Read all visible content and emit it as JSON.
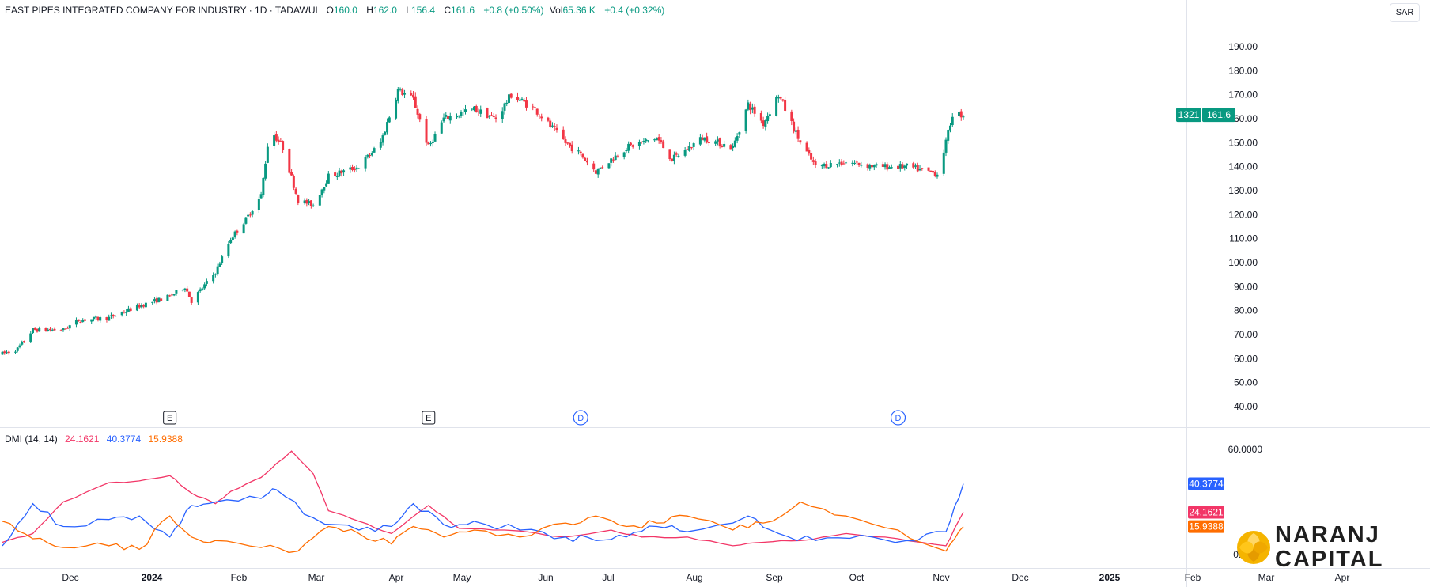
{
  "header": {
    "symbol": "EAST PIPES INTEGRATED COMPANY FOR INDUSTRY · 1D · TADAWUL",
    "open_label": "O",
    "open": "160.0",
    "high_label": "H",
    "high": "162.0",
    "low_label": "L",
    "low": "156.4",
    "close_label": "C",
    "close": "161.6",
    "change": "+0.8 (+0.50%)",
    "vol_label": "Vol",
    "vol": "65.36 K",
    "vol_change": "+0.4 (+0.32%)"
  },
  "currency": "SAR",
  "price_badge": {
    "count": "1321",
    "price": "161.6"
  },
  "dmi": {
    "title": "DMI (14, 14)",
    "minus_di": "24.1621",
    "adx": "40.3774",
    "plus_di": "15.9388"
  },
  "logo": {
    "line1": "NARANJ",
    "line2": "CAPITAL"
  },
  "colors": {
    "up": "#089981",
    "down": "#f23645",
    "minus_di": "#f23667",
    "adx": "#2962ff",
    "plus_di": "#ff6d00"
  },
  "chart_data": [
    {
      "type": "candlestick",
      "title": "EAST PIPES INTEGRATED COMPANY FOR INDUSTRY · 1D · TADAWUL",
      "y_ticks": [
        "40.00",
        "50.00",
        "60.00",
        "70.00",
        "80.00",
        "90.00",
        "100.00",
        "110.00",
        "120.00",
        "130.00",
        "140.00",
        "150.00",
        "160.00",
        "170.00",
        "180.00",
        "190.00"
      ],
      "ylim": [
        35,
        207
      ],
      "x_ticks": [
        "Dec",
        "2024",
        "Feb",
        "Mar",
        "Apr",
        "May",
        "Jun",
        "Jul",
        "Aug",
        "Sep",
        "Oct",
        "Nov",
        "Dec",
        "2025",
        "Feb",
        "Mar",
        "Apr"
      ],
      "close_trend": [
        {
          "date": "2023-11-13",
          "close": 62
        },
        {
          "date": "2023-11-20",
          "close": 64
        },
        {
          "date": "2023-11-27",
          "close": 72
        },
        {
          "date": "2023-12-11",
          "close": 72
        },
        {
          "date": "2023-12-18",
          "close": 76
        },
        {
          "date": "2024-01-01",
          "close": 77
        },
        {
          "date": "2024-01-15",
          "close": 82
        },
        {
          "date": "2024-01-29",
          "close": 86
        },
        {
          "date": "2024-02-05",
          "close": 90
        },
        {
          "date": "2024-02-08",
          "close": 84
        },
        {
          "date": "2024-02-19",
          "close": 96
        },
        {
          "date": "2024-02-26",
          "close": 110
        },
        {
          "date": "2024-03-04",
          "close": 118
        },
        {
          "date": "2024-03-11",
          "close": 128
        },
        {
          "date": "2024-03-15",
          "close": 156
        },
        {
          "date": "2024-03-21",
          "close": 148
        },
        {
          "date": "2024-03-28",
          "close": 126
        },
        {
          "date": "2024-04-04",
          "close": 124
        },
        {
          "date": "2024-04-11",
          "close": 136
        },
        {
          "date": "2024-04-25",
          "close": 140
        },
        {
          "date": "2024-05-05",
          "close": 150
        },
        {
          "date": "2024-05-13",
          "close": 172
        },
        {
          "date": "2024-05-20",
          "close": 168
        },
        {
          "date": "2024-05-27",
          "close": 148
        },
        {
          "date": "2024-06-03",
          "close": 160
        },
        {
          "date": "2024-06-17",
          "close": 164
        },
        {
          "date": "2024-06-27",
          "close": 160
        },
        {
          "date": "2024-07-04",
          "close": 170
        },
        {
          "date": "2024-07-15",
          "close": 164
        },
        {
          "date": "2024-07-29",
          "close": 150
        },
        {
          "date": "2024-08-05",
          "close": 145
        },
        {
          "date": "2024-08-12",
          "close": 138
        },
        {
          "date": "2024-08-26",
          "close": 148
        },
        {
          "date": "2024-09-09",
          "close": 152
        },
        {
          "date": "2024-09-16",
          "close": 143
        },
        {
          "date": "2024-09-30",
          "close": 152
        },
        {
          "date": "2024-10-14",
          "close": 148
        },
        {
          "date": "2024-10-21",
          "close": 166
        },
        {
          "date": "2024-10-28",
          "close": 158
        },
        {
          "date": "2024-11-04",
          "close": 170
        },
        {
          "date": "2024-11-14",
          "close": 150
        },
        {
          "date": "2024-11-21",
          "close": 140
        },
        {
          "date": "2024-12-05",
          "close": 142
        },
        {
          "date": "2024-12-19",
          "close": 140
        },
        {
          "date": "2025-01-02",
          "close": 140
        },
        {
          "date": "2025-01-16",
          "close": 137
        },
        {
          "date": "2025-01-20",
          "close": 150
        },
        {
          "date": "2025-01-23",
          "close": 162
        },
        {
          "date": "2025-01-28",
          "close": 161.6
        }
      ],
      "events": [
        {
          "label": "E",
          "date": "2024-01-29"
        },
        {
          "label": "E",
          "date": "2024-05-27"
        },
        {
          "label": "D",
          "date": "2024-08-05"
        },
        {
          "label": "D",
          "date": "2024-12-29"
        }
      ]
    },
    {
      "type": "line",
      "title": "DMI (14, 14)",
      "y_ticks": [
        "0.0000",
        "60.0000"
      ],
      "ylim": [
        -4,
        67
      ],
      "series": [
        {
          "name": "-DI",
          "values": [
            {
              "date": "2023-11-13",
              "v": 7
            },
            {
              "date": "2023-11-27",
              "v": 12
            },
            {
              "date": "2023-12-11",
              "v": 30
            },
            {
              "date": "2024-01-01",
              "v": 41
            },
            {
              "date": "2024-01-15",
              "v": 42
            },
            {
              "date": "2024-01-29",
              "v": 45
            },
            {
              "date": "2024-02-08",
              "v": 35
            },
            {
              "date": "2024-02-19",
              "v": 29
            },
            {
              "date": "2024-02-26",
              "v": 36
            },
            {
              "date": "2024-03-11",
              "v": 44
            },
            {
              "date": "2024-03-25",
              "v": 59
            },
            {
              "date": "2024-04-04",
              "v": 46
            },
            {
              "date": "2024-04-11",
              "v": 25
            },
            {
              "date": "2024-04-25",
              "v": 19
            },
            {
              "date": "2024-05-10",
              "v": 12
            },
            {
              "date": "2024-05-27",
              "v": 28
            },
            {
              "date": "2024-06-10",
              "v": 15
            },
            {
              "date": "2024-07-01",
              "v": 14
            },
            {
              "date": "2024-07-29",
              "v": 10
            },
            {
              "date": "2024-08-19",
              "v": 14
            },
            {
              "date": "2024-09-02",
              "v": 10
            },
            {
              "date": "2024-09-23",
              "v": 10
            },
            {
              "date": "2024-10-14",
              "v": 5
            },
            {
              "date": "2024-10-28",
              "v": 7
            },
            {
              "date": "2024-11-14",
              "v": 8
            },
            {
              "date": "2024-12-05",
              "v": 12
            },
            {
              "date": "2024-12-29",
              "v": 9
            },
            {
              "date": "2025-01-20",
              "v": 5
            },
            {
              "date": "2025-01-28",
              "v": 24.1621
            }
          ]
        },
        {
          "name": "ADX",
          "values": [
            {
              "date": "2023-11-13",
              "v": 5
            },
            {
              "date": "2023-11-27",
              "v": 29
            },
            {
              "date": "2023-12-11",
              "v": 16
            },
            {
              "date": "2024-01-01",
              "v": 20
            },
            {
              "date": "2024-01-15",
              "v": 22
            },
            {
              "date": "2024-01-29",
              "v": 10
            },
            {
              "date": "2024-02-08",
              "v": 28
            },
            {
              "date": "2024-02-19",
              "v": 30
            },
            {
              "date": "2024-03-11",
              "v": 32
            },
            {
              "date": "2024-03-18",
              "v": 37
            },
            {
              "date": "2024-04-04",
              "v": 21
            },
            {
              "date": "2024-04-25",
              "v": 14
            },
            {
              "date": "2024-05-10",
              "v": 16
            },
            {
              "date": "2024-05-20",
              "v": 29
            },
            {
              "date": "2024-06-03",
              "v": 17
            },
            {
              "date": "2024-06-17",
              "v": 19
            },
            {
              "date": "2024-07-08",
              "v": 14
            },
            {
              "date": "2024-07-29",
              "v": 10
            },
            {
              "date": "2024-08-12",
              "v": 8
            },
            {
              "date": "2024-08-26",
              "v": 10
            },
            {
              "date": "2024-09-09",
              "v": 16
            },
            {
              "date": "2024-09-23",
              "v": 13
            },
            {
              "date": "2024-10-21",
              "v": 22
            },
            {
              "date": "2024-11-04",
              "v": 12
            },
            {
              "date": "2024-11-21",
              "v": 8
            },
            {
              "date": "2024-12-12",
              "v": 11
            },
            {
              "date": "2025-01-02",
              "v": 8
            },
            {
              "date": "2025-01-20",
              "v": 13
            },
            {
              "date": "2025-01-28",
              "v": 40.3774
            }
          ]
        },
        {
          "name": "+DI",
          "values": [
            {
              "date": "2023-11-13",
              "v": 19
            },
            {
              "date": "2023-11-27",
              "v": 9
            },
            {
              "date": "2023-12-11",
              "v": 4
            },
            {
              "date": "2024-01-01",
              "v": 5
            },
            {
              "date": "2024-01-15",
              "v": 3
            },
            {
              "date": "2024-01-29",
              "v": 22
            },
            {
              "date": "2024-02-08",
              "v": 10
            },
            {
              "date": "2024-02-19",
              "v": 8
            },
            {
              "date": "2024-03-11",
              "v": 4
            },
            {
              "date": "2024-03-28",
              "v": 2
            },
            {
              "date": "2024-04-11",
              "v": 16
            },
            {
              "date": "2024-04-25",
              "v": 12
            },
            {
              "date": "2024-05-10",
              "v": 6
            },
            {
              "date": "2024-05-20",
              "v": 16
            },
            {
              "date": "2024-06-03",
              "v": 10
            },
            {
              "date": "2024-06-17",
              "v": 14
            },
            {
              "date": "2024-07-08",
              "v": 10
            },
            {
              "date": "2024-07-29",
              "v": 18
            },
            {
              "date": "2024-08-12",
              "v": 22
            },
            {
              "date": "2024-08-26",
              "v": 16
            },
            {
              "date": "2024-09-09",
              "v": 18
            },
            {
              "date": "2024-09-23",
              "v": 22
            },
            {
              "date": "2024-10-14",
              "v": 14
            },
            {
              "date": "2024-10-28",
              "v": 18
            },
            {
              "date": "2024-11-14",
              "v": 30
            },
            {
              "date": "2024-12-05",
              "v": 22
            },
            {
              "date": "2024-12-29",
              "v": 14
            },
            {
              "date": "2025-01-20",
              "v": 2
            },
            {
              "date": "2025-01-28",
              "v": 15.9388
            }
          ]
        }
      ]
    }
  ]
}
